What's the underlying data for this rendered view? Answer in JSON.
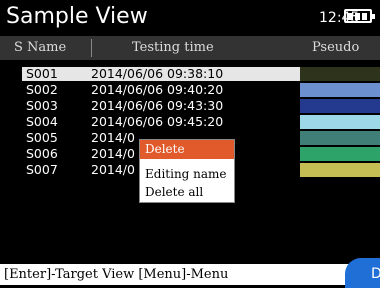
{
  "title": "Sample View",
  "clock": "12:45",
  "columns": {
    "name": "S Name",
    "time": "Testing time",
    "pseudo": "Pseudo"
  },
  "rows": [
    {
      "name": "S001",
      "time": "2014/06/06 09:38:10",
      "color": "#2e331c"
    },
    {
      "name": "S002",
      "time": "2014/06/06 09:40:20",
      "color": "#6c8fd0"
    },
    {
      "name": "S003",
      "time": "2014/06/06 09:43:30",
      "color": "#233a8e"
    },
    {
      "name": "S004",
      "time": "2014/06/06 09:45:20",
      "color": "#9dd8e8"
    },
    {
      "name": "S005",
      "time": "2014/0",
      "color": "#3f7f78"
    },
    {
      "name": "S006",
      "time": "2014/0",
      "color": "#2da36a"
    },
    {
      "name": "S007",
      "time": "2014/0",
      "color": "#c4be55"
    }
  ],
  "context_menu": {
    "delete": "Delete",
    "edit": "Editing name",
    "delete_all": "Delete all"
  },
  "footer": {
    "hint": "[Enter]-Target View  [Menu]-Menu",
    "corner_label": "D"
  },
  "selected_row_color": "#e6e6e6",
  "menu_highlight_color": "#e05a2b"
}
